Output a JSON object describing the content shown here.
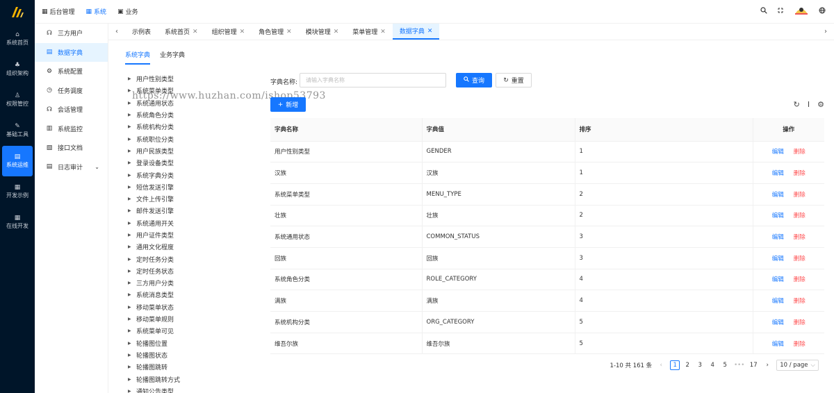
{
  "rail": {
    "items": [
      {
        "label": "系统首页",
        "icon": "home-icon",
        "glyph": "⌂"
      },
      {
        "label": "组织架构",
        "icon": "org-icon",
        "glyph": "♣"
      },
      {
        "label": "权限管控",
        "icon": "user-icon",
        "glyph": "♙"
      },
      {
        "label": "基础工具",
        "icon": "tool-icon",
        "glyph": "✎"
      },
      {
        "label": "系统运维",
        "icon": "ops-icon",
        "glyph": "▤"
      },
      {
        "label": "开发示例",
        "icon": "example-icon",
        "glyph": "▦"
      },
      {
        "label": "在线开发",
        "icon": "code-icon",
        "glyph": "▦"
      }
    ]
  },
  "topnav": {
    "items": [
      {
        "label": "后台管理",
        "glyph": "▦"
      },
      {
        "label": "系统",
        "glyph": "▦"
      },
      {
        "label": "业务",
        "glyph": "▣"
      }
    ]
  },
  "menu": {
    "items": [
      {
        "label": "三方用户",
        "glyph": "☊"
      },
      {
        "label": "数据字典",
        "glyph": "▤"
      },
      {
        "label": "系统配置",
        "glyph": "⚙"
      },
      {
        "label": "任务调度",
        "glyph": "◷"
      },
      {
        "label": "会话管理",
        "glyph": "☊"
      },
      {
        "label": "系统监控",
        "glyph": "▥"
      },
      {
        "label": "接口文档",
        "glyph": "▧"
      },
      {
        "label": "日志审计",
        "glyph": "▤"
      }
    ]
  },
  "tabs": {
    "items": [
      {
        "label": "示例表",
        "closable": ""
      },
      {
        "label": "系统首页",
        "closable": "✕"
      },
      {
        "label": "组织管理",
        "closable": "✕"
      },
      {
        "label": "角色管理",
        "closable": "✕"
      },
      {
        "label": "模块管理",
        "closable": "✕"
      },
      {
        "label": "菜单管理",
        "closable": "✕"
      },
      {
        "label": "数据字典",
        "closable": "✕"
      }
    ]
  },
  "subtabs": [
    "系统字典",
    "业务字典"
  ],
  "watermark": "https://www.huzhan.com/ishop53793",
  "tree": [
    "用户性别类型",
    "系统菜单类型",
    "系统通用状态",
    "系统角色分类",
    "系统机构分类",
    "系统职位分类",
    "用户民族类型",
    "登录设备类型",
    "系统字典分类",
    "短信发送引擎",
    "文件上传引擎",
    "邮件发送引擎",
    "系统通用开关",
    "用户证件类型",
    "通用文化程度",
    "定时任务分类",
    "定时任务状态",
    "三方用户分类",
    "系统消息类型",
    "移动菜单状态",
    "移动菜单规则",
    "系统菜单可见",
    "轮播图位置",
    "轮播图状态",
    "轮播图跳转",
    "轮播图跳转方式",
    "通知公告类型"
  ],
  "search": {
    "label": "字典名称:",
    "placeholder": "请输入字典名称",
    "query_label": "查询",
    "reset_label": "重置"
  },
  "toolbar": {
    "add_label": "新增"
  },
  "table": {
    "columns": [
      "字典名称",
      "字典值",
      "排序",
      "操作"
    ],
    "edit_label": "编辑",
    "delete_label": "删除",
    "rows": [
      [
        "用户性别类型",
        "GENDER",
        "1"
      ],
      [
        "汉族",
        "汉族",
        "1"
      ],
      [
        "系统菜单类型",
        "MENU_TYPE",
        "2"
      ],
      [
        "壮族",
        "壮族",
        "2"
      ],
      [
        "系统通用状态",
        "COMMON_STATUS",
        "3"
      ],
      [
        "回族",
        "回族",
        "3"
      ],
      [
        "系统角色分类",
        "ROLE_CATEGORY",
        "4"
      ],
      [
        "满族",
        "满族",
        "4"
      ],
      [
        "系统机构分类",
        "ORG_CATEGORY",
        "5"
      ],
      [
        "维吾尔族",
        "维吾尔族",
        "5"
      ]
    ]
  },
  "pagination": {
    "total": "1-10 共 161 条",
    "pages": [
      "1",
      "2",
      "3",
      "4",
      "5"
    ],
    "ellipsis": "•••",
    "last": "17",
    "page_size": "10 / page"
  },
  "colors": {
    "primary": "#1677ff",
    "danger": "#ff4d4f",
    "rail": "#001529"
  }
}
